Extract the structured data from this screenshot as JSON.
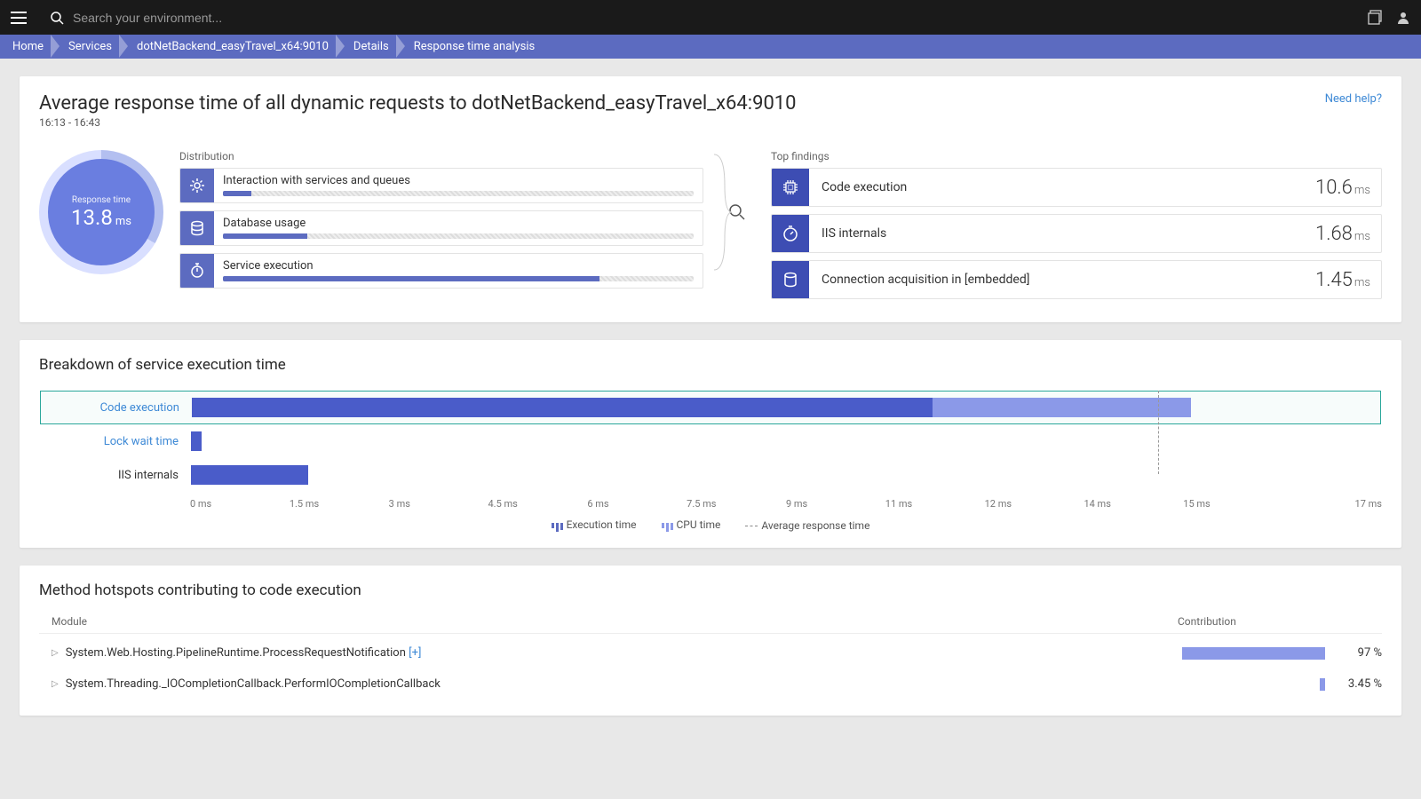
{
  "topbar": {
    "search_placeholder": "Search your environment..."
  },
  "breadcrumb": [
    "Home",
    "Services",
    "dotNetBackend_easyTravel_x64:9010",
    "Details",
    "Response time analysis"
  ],
  "header": {
    "title": "Average response time of all dynamic requests to dotNetBackend_easyTravel_x64:9010",
    "timerange": "16:13 - 16:43",
    "help": "Need help?"
  },
  "gauge": {
    "label": "Response time",
    "value": "13.8",
    "unit": "ms"
  },
  "distribution": {
    "label": "Distribution",
    "items": [
      {
        "name": "Interaction with services and queues",
        "pct": 6,
        "icon": "gear-icon"
      },
      {
        "name": "Database usage",
        "pct": 18,
        "icon": "database-icon"
      },
      {
        "name": "Service execution",
        "pct": 80,
        "icon": "stopwatch-icon"
      }
    ]
  },
  "findings": {
    "label": "Top findings",
    "items": [
      {
        "name": "Code execution",
        "value": "10.6",
        "unit": "ms",
        "icon": "chip-icon"
      },
      {
        "name": "IIS internals",
        "value": "1.68",
        "unit": "ms",
        "icon": "timer-icon"
      },
      {
        "name": "Connection acquisition in [embedded]",
        "value": "1.45",
        "unit": "ms",
        "icon": "db-icon"
      }
    ]
  },
  "breakdown": {
    "title": "Breakdown of service execution time",
    "legend": {
      "exec": "Execution time",
      "cpu": "CPU time",
      "avg": "Average response time"
    },
    "axis_max": 17,
    "avg_marker": 13.8
  },
  "chart_data": {
    "type": "bar",
    "title": "Breakdown of service execution time",
    "xlabel": "ms",
    "xlim": [
      0,
      17
    ],
    "x_ticks": [
      "0 ms",
      "1.5 ms",
      "3 ms",
      "4.5 ms",
      "6 ms",
      "7.5 ms",
      "9 ms",
      "11 ms",
      "12 ms",
      "14 ms",
      "15 ms",
      "17 ms"
    ],
    "categories": [
      "Code execution",
      "Lock wait time",
      "IIS internals"
    ],
    "series": [
      {
        "name": "Execution time",
        "values": [
          10.6,
          0.15,
          1.68
        ]
      },
      {
        "name": "CPU time",
        "values": [
          3.7,
          0,
          0
        ]
      }
    ],
    "reference_line": {
      "label": "Average response time",
      "value": 13.8
    },
    "selected_row": 0,
    "link_rows": [
      0,
      1
    ]
  },
  "hotspots": {
    "title": "Method hotspots contributing to code execution",
    "columns": {
      "module": "Module",
      "contribution": "Contribution"
    },
    "rows": [
      {
        "name": "System.Web.Hosting.PipelineRuntime.ProcessRequestNotification",
        "expander": "[+]",
        "pct": 97
      },
      {
        "name": "System.Threading._IOCompletionCallback.PerformIOCompletionCallback",
        "expander": "",
        "pct": 3.45
      }
    ]
  }
}
